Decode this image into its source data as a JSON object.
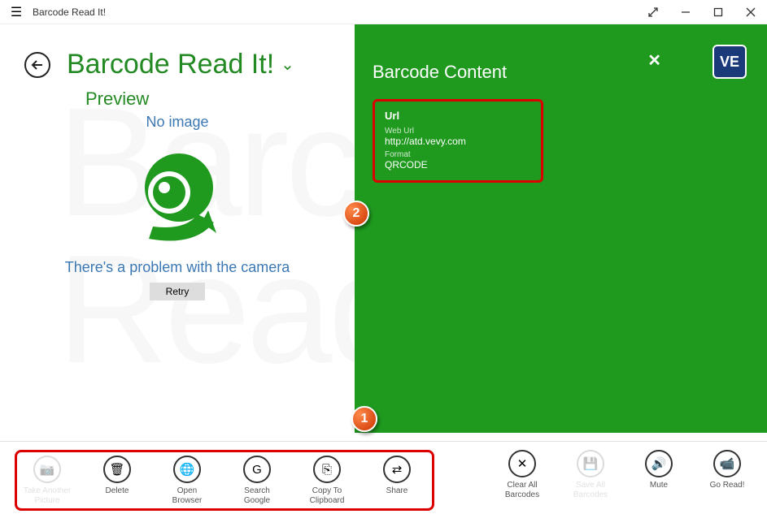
{
  "window": {
    "title": "Barcode Read It!"
  },
  "header": {
    "page_title": "Barcode Read It!"
  },
  "preview": {
    "section_title": "Preview",
    "no_image": "No image",
    "problem_text": "There's a problem with the camera",
    "retry_label": "Retry"
  },
  "panel": {
    "title": "Barcode Content",
    "close_glyph": "✕",
    "url_section": {
      "heading": "Url",
      "web_url_label": "Web Url",
      "web_url_value": "http://atd.vevy.com",
      "format_label": "Format",
      "format_value": "QRCODE"
    }
  },
  "logo": {
    "text": "VE"
  },
  "markers": {
    "m1": "1",
    "m2": "2"
  },
  "toolbar": {
    "left": [
      {
        "id": "take-picture",
        "label": "Take Another Picture",
        "icon": "📷",
        "disabled": true
      },
      {
        "id": "delete",
        "label": "Delete",
        "icon": "🗑",
        "disabled": false
      },
      {
        "id": "open-browser",
        "label": "Open Browser",
        "icon": "🌐",
        "disabled": false
      },
      {
        "id": "search-google",
        "label": "Search Google",
        "icon": "G",
        "disabled": false
      },
      {
        "id": "copy-clipboard",
        "label": "Copy To Clipboard",
        "icon": "⎘",
        "disabled": false
      },
      {
        "id": "share",
        "label": "Share",
        "icon": "⇄",
        "disabled": false
      }
    ],
    "right": [
      {
        "id": "clear-all",
        "label": "Clear All Barcodes",
        "icon": "✕",
        "disabled": false
      },
      {
        "id": "save-all",
        "label": "Save All Barcodes",
        "icon": "💾",
        "disabled": true
      },
      {
        "id": "mute",
        "label": "Mute",
        "icon": "🔊",
        "disabled": false
      },
      {
        "id": "go-read",
        "label": "Go Read!",
        "icon": "📹",
        "disabled": false
      }
    ]
  }
}
